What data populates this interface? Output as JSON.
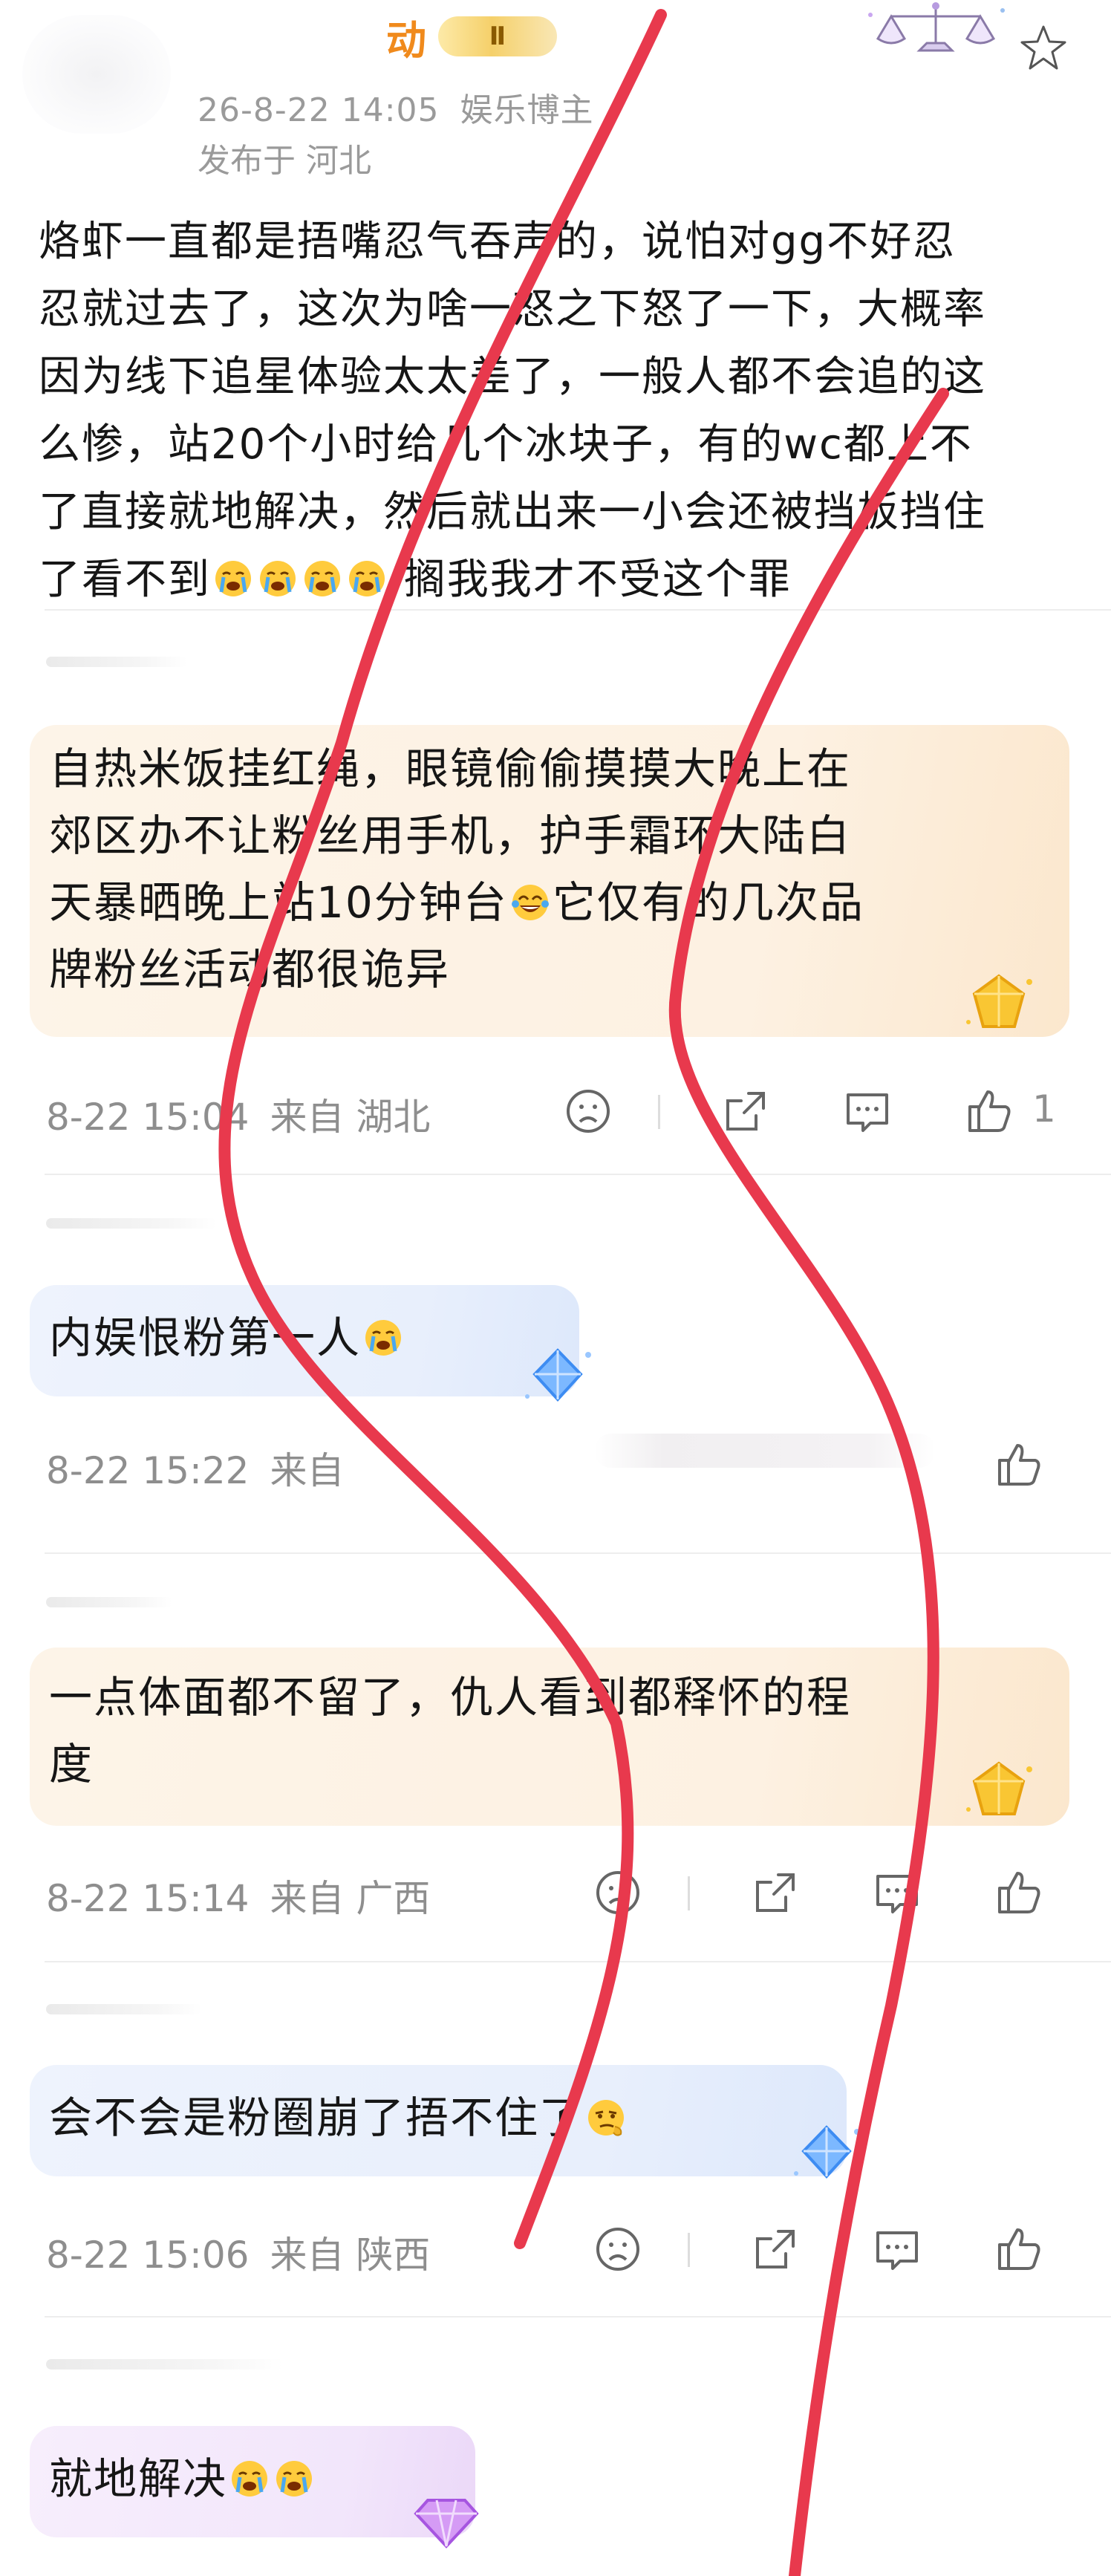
{
  "header": {
    "username": "动",
    "level": "Ⅱ",
    "date": "26-8-22 14:05",
    "role": "娱乐博主",
    "location": "发布于 河北"
  },
  "post": {
    "lines": [
      "烙虾一直都是捂嘴忍气吞声的，说怕对gg不好忍",
      "忍就过去了，这次为啥一怒之下怒了一下，大概率",
      "因为线下追星体验太太差了，一般人都不会追的这",
      "么惨，站20个小时给几个冰块子，有的wc都上不",
      "了直接就地解决，然后就出来一小会还被挡板挡住",
      "了看不到",
      " 搁我我才不受这个罪"
    ]
  },
  "comments": [
    {
      "lines": [
        "自热米饭挂红绳，眼镜偷偷摸摸大晚上在",
        "郊区办不让粉丝用手机，护手霜环大陆白",
        "天暴晒晚上站10分钟台",
        "它仅有的几次品",
        "牌粉丝活动都很诡异"
      ],
      "time": "8-22 15:04",
      "from": "来自",
      "region": "湖北",
      "likes": "1",
      "tier": "gold"
    },
    {
      "text": "内娱恨粉第一人",
      "time": "8-22 15:22",
      "from": "来自",
      "region": "",
      "likes": "",
      "tier": "blue"
    },
    {
      "lines": [
        "一点体面都不留了，仇人看到都释怀的程",
        "度"
      ],
      "time": "8-22 15:14",
      "from": "来自",
      "region": "广西",
      "likes": "",
      "tier": "gold"
    },
    {
      "text": "会不会是粉圈崩了捂不住了",
      "time": "8-22 15:06",
      "from": "来自",
      "region": "陕西",
      "likes": "",
      "tier": "blue"
    },
    {
      "text": "就地解决",
      "tier": "purple"
    }
  ],
  "icons": {
    "sad": "sad-face-icon",
    "share": "share-icon",
    "comment": "comment-icon",
    "like": "thumbs-up-icon",
    "star": "star-icon",
    "crying": "crying-emoji-icon",
    "laughing": "tears-of-joy-emoji-icon",
    "thinking": "smirk-emoji-icon"
  },
  "colors": {
    "username": "#f08a1c",
    "annotation": "#e8394d",
    "meta": "#8e8e8e"
  }
}
